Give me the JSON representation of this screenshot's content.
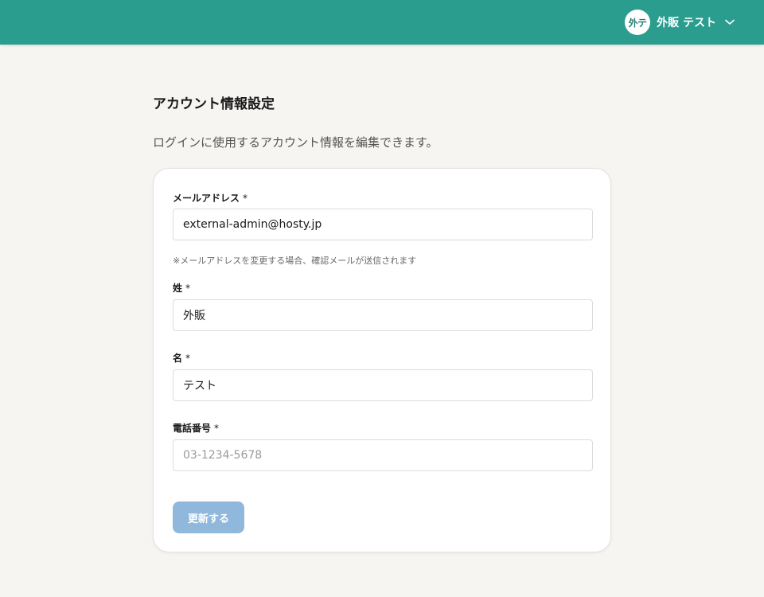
{
  "header": {
    "user": {
      "avatar_text": "外テ",
      "name": "外販 テスト"
    },
    "accent_color": "#2a9d8f"
  },
  "page": {
    "title": "アカウント情報設定",
    "description": "ログインに使用するアカウント情報を編集できます。"
  },
  "form": {
    "email": {
      "label": "メールアドレス",
      "required_mark": "*",
      "value": "external-admin@hosty.jp",
      "hint": "※メールアドレスを変更する場合、確認メールが送信されます"
    },
    "last_name": {
      "label": "姓",
      "required_mark": "*",
      "value": "外販"
    },
    "first_name": {
      "label": "名",
      "required_mark": "*",
      "value": "テスト"
    },
    "phone": {
      "label": "電話番号",
      "required_mark": "*",
      "value": "",
      "placeholder": "03-1234-5678"
    },
    "submit_label": "更新する",
    "submit_color": "#8fb8dc"
  }
}
